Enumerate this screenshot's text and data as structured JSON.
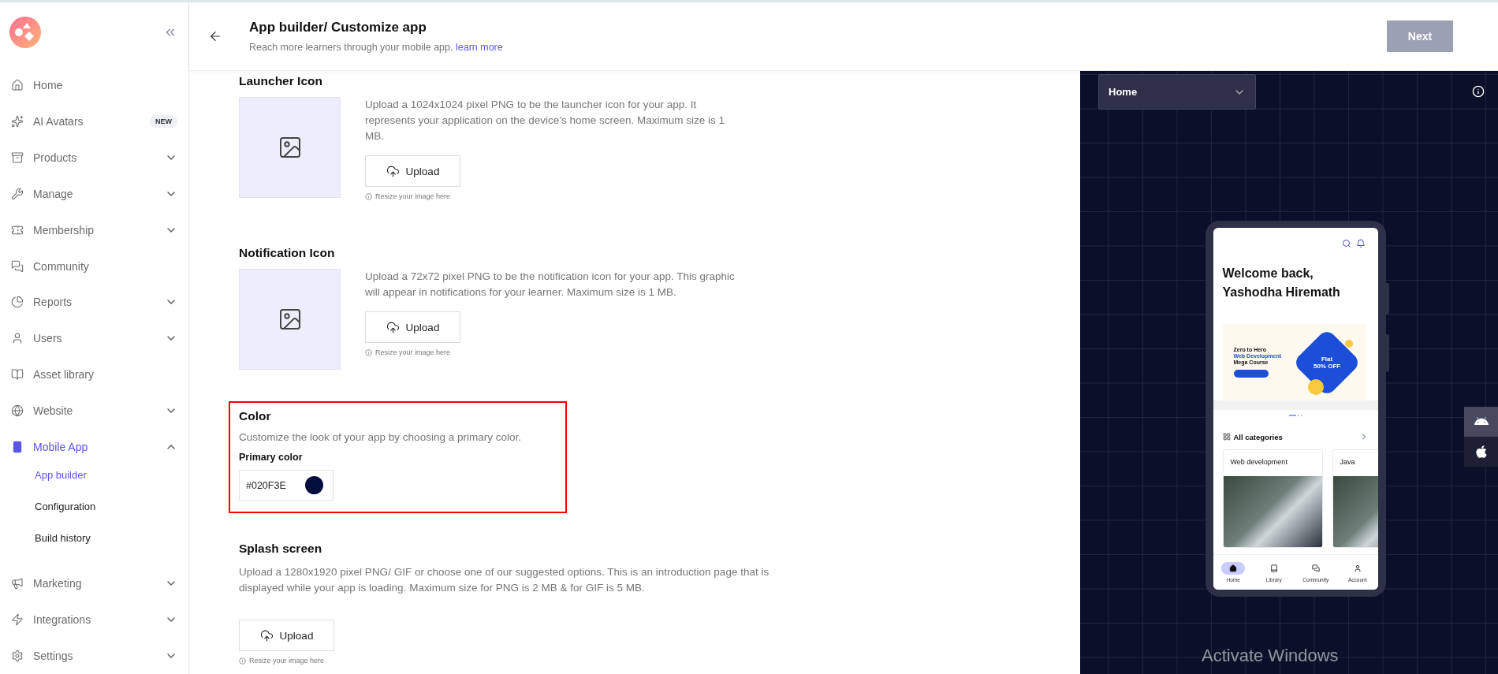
{
  "sidebar": {
    "items": [
      {
        "label": "Home",
        "selected": false
      },
      {
        "label": "AI Avatars",
        "selected": false,
        "badge": "NEW"
      },
      {
        "label": "Products",
        "selected": false,
        "expanded": false
      },
      {
        "label": "Manage",
        "selected": false,
        "expanded": false
      },
      {
        "label": "Membership",
        "selected": false,
        "expanded": false
      },
      {
        "label": "Community",
        "selected": false
      },
      {
        "label": "Reports",
        "selected": false,
        "expanded": false
      },
      {
        "label": "Users",
        "selected": false,
        "expanded": false
      },
      {
        "label": "Asset library",
        "selected": false
      },
      {
        "label": "Website",
        "selected": false,
        "expanded": false
      },
      {
        "label": "Mobile App",
        "selected": true,
        "expanded": true,
        "children": [
          {
            "label": "App builder",
            "selected": true
          },
          {
            "label": "Configuration",
            "selected": false
          },
          {
            "label": "Build history",
            "selected": false
          }
        ]
      },
      {
        "label": "Marketing",
        "selected": false,
        "expanded": false
      },
      {
        "label": "Integrations",
        "selected": false,
        "expanded": false
      },
      {
        "label": "Settings",
        "selected": false,
        "expanded": false
      }
    ]
  },
  "header": {
    "title": "App builder/ Customize app",
    "subtitle": "Reach more learners through your mobile app.",
    "link": "learn more",
    "next_button": {
      "label": "Next",
      "disabled": true
    }
  },
  "sections": [
    {
      "kind": "icon_upload",
      "title": "Launcher Icon",
      "description": "Upload a 1024x1024 pixel PNG to be the launcher icon for your app. It represents your application on the device’s home screen. Maximum size is 1 MB.",
      "button": "Upload",
      "hint": "Resize your image here"
    },
    {
      "kind": "icon_upload",
      "title": "Notification Icon",
      "description": "Upload a 72x72 pixel PNG to be the notification icon for your app. This graphic will appear in notifications for your learner. Maximum size is 1 MB.",
      "button": "Upload",
      "hint": "Resize your image here"
    },
    {
      "kind": "color",
      "title": "Color",
      "description": "Customize the look of your app by choosing a primary color.",
      "field_label": "Primary color",
      "value": "#020F3E",
      "color": "#020f3e",
      "highlighted": true
    },
    {
      "kind": "upload",
      "title": "Splash screen",
      "description": "Upload a 1280x1920 pixel PNG/ GIF or choose one of our suggested options. This is an introduction page that is displayed while your app is loading. Maximum size for PNG is 2 MB & for GIF is 5 MB.",
      "button": "Upload",
      "hint": "Resize your image here"
    }
  ],
  "preview": {
    "screen_select": "Home",
    "platforms": [
      {
        "kind": "android",
        "selected": true
      },
      {
        "kind": "apple",
        "selected": false
      }
    ],
    "phone": {
      "greeting": [
        "Welcome back,",
        "Yashodha Hiremath"
      ],
      "banner": {
        "lines": [
          "Zero to Hero",
          "Web Development",
          "Mega Course"
        ],
        "offer": [
          "Flat",
          "50% OFF"
        ]
      },
      "categories_title": "All categories",
      "categories": [
        "Web development",
        "Java"
      ],
      "nav": [
        {
          "label": "Home",
          "selected": true
        },
        {
          "label": "Library",
          "selected": false
        },
        {
          "label": "Community",
          "selected": false
        },
        {
          "label": "Account",
          "selected": false
        }
      ]
    }
  },
  "os_watermark": "Activate Windows"
}
